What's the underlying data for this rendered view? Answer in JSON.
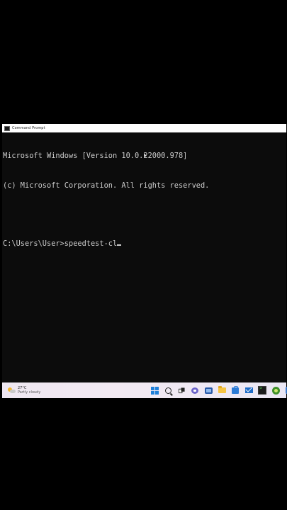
{
  "window": {
    "title": "Command Prompt"
  },
  "console": {
    "lines": [
      "Microsoft Windows [Version 10.0.22000.978]",
      "(c) Microsoft Corporation. All rights reserved.",
      "",
      "C:\\Users\\User>speedtest-cl"
    ]
  },
  "taskbar": {
    "weather": {
      "temperature": "27°C",
      "condition": "Partly cloudy",
      "icon": "partly-cloudy-icon"
    },
    "apps": [
      {
        "name": "start",
        "icon": "windows-logo-icon"
      },
      {
        "name": "search",
        "icon": "search-icon"
      },
      {
        "name": "task-view",
        "icon": "task-view-icon"
      },
      {
        "name": "chat",
        "icon": "chat-icon"
      },
      {
        "name": "widgets",
        "icon": "widgets-icon"
      },
      {
        "name": "file-explorer",
        "icon": "folder-icon"
      },
      {
        "name": "store",
        "icon": "store-icon"
      },
      {
        "name": "mail",
        "icon": "mail-icon"
      },
      {
        "name": "terminal",
        "icon": "terminal-icon"
      },
      {
        "name": "app",
        "icon": "app-icon"
      },
      {
        "name": "app",
        "icon": "app-icon"
      }
    ]
  },
  "colors": {
    "console_background": "#0c0c0c",
    "console_text": "#cccccc",
    "start_accent": "#1e7fd8"
  }
}
